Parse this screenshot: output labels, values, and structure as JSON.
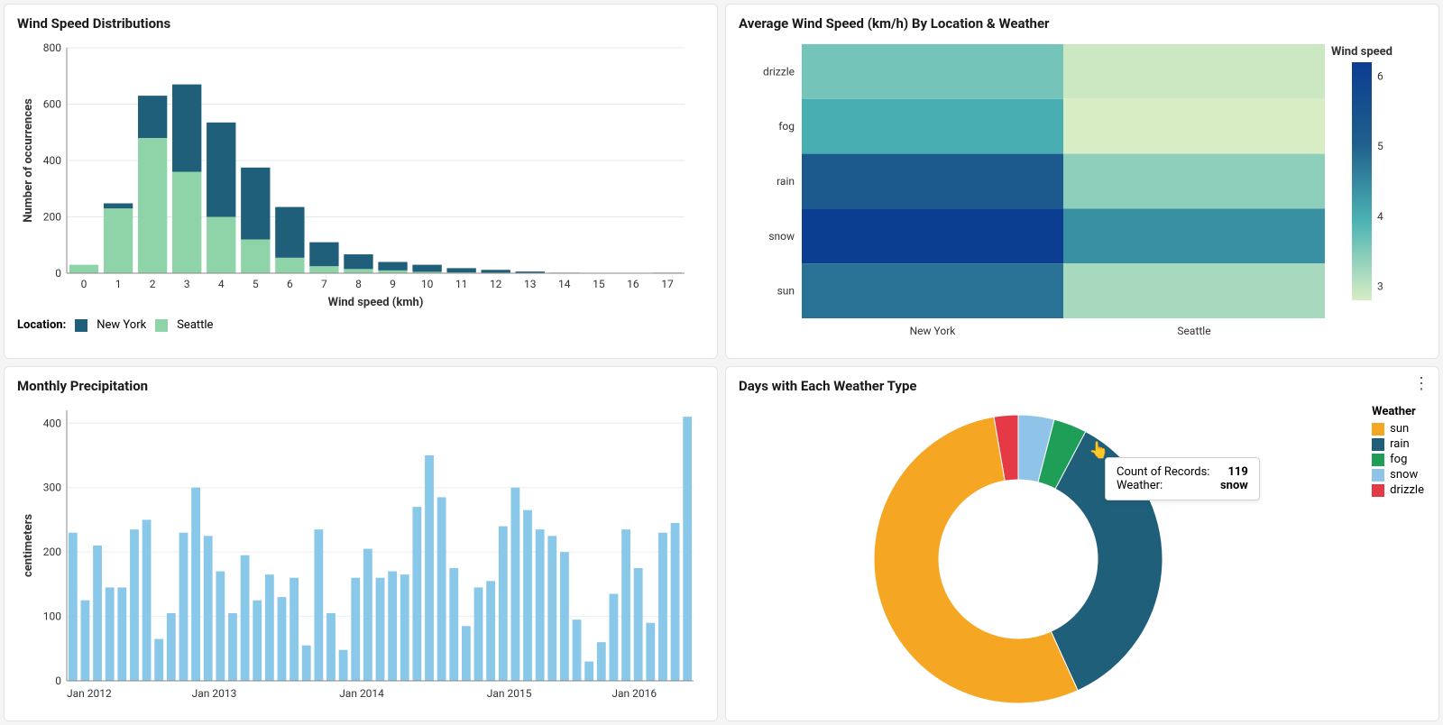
{
  "panels": {
    "wind_dist": {
      "title": "Wind Speed Distributions",
      "xlabel": "Wind speed (kmh)",
      "ylabel": "Number of occurrences",
      "legend_label": "Location:",
      "legend": [
        {
          "name": "New York",
          "color": "#1f5f7a"
        },
        {
          "name": "Seattle",
          "color": "#8fd4a8"
        }
      ]
    },
    "heatmap": {
      "title": "Average Wind Speed (km/h) By Location & Weather",
      "colorbar_title": "Wind speed"
    },
    "precip": {
      "title": "Monthly Precipitation",
      "ylabel": "centimeters"
    },
    "donut": {
      "title": "Days with Each Weather Type",
      "legend_title": "Weather",
      "tooltip": {
        "row1_label": "Count of Records:",
        "row1_value": "119",
        "row2_label": "Weather:",
        "row2_value": "snow"
      }
    }
  },
  "chart_data": [
    {
      "id": "wind_dist",
      "type": "bar",
      "stacked": true,
      "categories": [
        0,
        1,
        2,
        3,
        4,
        5,
        6,
        7,
        8,
        9,
        10,
        11,
        12,
        13,
        14,
        15,
        16,
        17
      ],
      "series": [
        {
          "name": "Seattle",
          "color": "#8fd4a8",
          "values": [
            30,
            230,
            480,
            360,
            200,
            120,
            55,
            25,
            15,
            10,
            5,
            3,
            2,
            1,
            0,
            0,
            0,
            0
          ]
        },
        {
          "name": "New York",
          "color": "#1f5f7a",
          "values": [
            0,
            18,
            150,
            310,
            335,
            255,
            180,
            85,
            52,
            30,
            25,
            15,
            10,
            5,
            2,
            1,
            0,
            2
          ]
        }
      ],
      "xlabel": "Wind speed (kmh)",
      "ylabel": "Number of occurrences",
      "ylim": [
        0,
        800
      ],
      "yticks": [
        0,
        200,
        400,
        600,
        800
      ]
    },
    {
      "id": "heatmap",
      "type": "heatmap",
      "x": [
        "New York",
        "Seattle"
      ],
      "y": [
        "drizzle",
        "fog",
        "rain",
        "snow",
        "sun"
      ],
      "values": [
        [
          3.6,
          2.9
        ],
        [
          4.0,
          2.8
        ],
        [
          5.2,
          3.4
        ],
        [
          6.2,
          4.4
        ],
        [
          4.8,
          3.2
        ]
      ],
      "colorbar": {
        "title": "Wind speed",
        "range": [
          2.8,
          6.2
        ],
        "ticks": [
          3,
          4,
          5,
          6
        ]
      },
      "colors_low_high": [
        "#d8edc4",
        "#0b3d91"
      ]
    },
    {
      "id": "precip",
      "type": "bar",
      "xlabel_ticks": [
        "Jan 2012",
        "Jan 2013",
        "Jan 2014",
        "Jan 2015",
        "Jan 2016"
      ],
      "ylabel": "centimeters",
      "ylim": [
        0,
        420
      ],
      "yticks": [
        0,
        100,
        200,
        300,
        400
      ],
      "color": "#89c8e8",
      "values": [
        230,
        125,
        210,
        145,
        145,
        235,
        250,
        65,
        105,
        230,
        300,
        225,
        170,
        105,
        195,
        125,
        165,
        130,
        160,
        55,
        235,
        105,
        48,
        160,
        205,
        160,
        170,
        165,
        270,
        350,
        285,
        175,
        85,
        145,
        155,
        240,
        300,
        265,
        235,
        225,
        200,
        95,
        30,
        60,
        135,
        235,
        175,
        90,
        230,
        245,
        410
      ],
      "x_start": "2012-01",
      "x_step_months": 1
    },
    {
      "id": "donut",
      "type": "pie",
      "hole": 0.55,
      "series": [
        {
          "name": "sun",
          "color": "#f5a623",
          "value": 1600
        },
        {
          "name": "rain",
          "color": "#1f5f7a",
          "value": 1050
        },
        {
          "name": "fog",
          "color": "#1e9e57",
          "value": 110
        },
        {
          "name": "snow",
          "color": "#8fc4e8",
          "value": 119
        },
        {
          "name": "drizzle",
          "color": "#e63946",
          "value": 80
        }
      ],
      "tooltip_target": "snow"
    }
  ]
}
